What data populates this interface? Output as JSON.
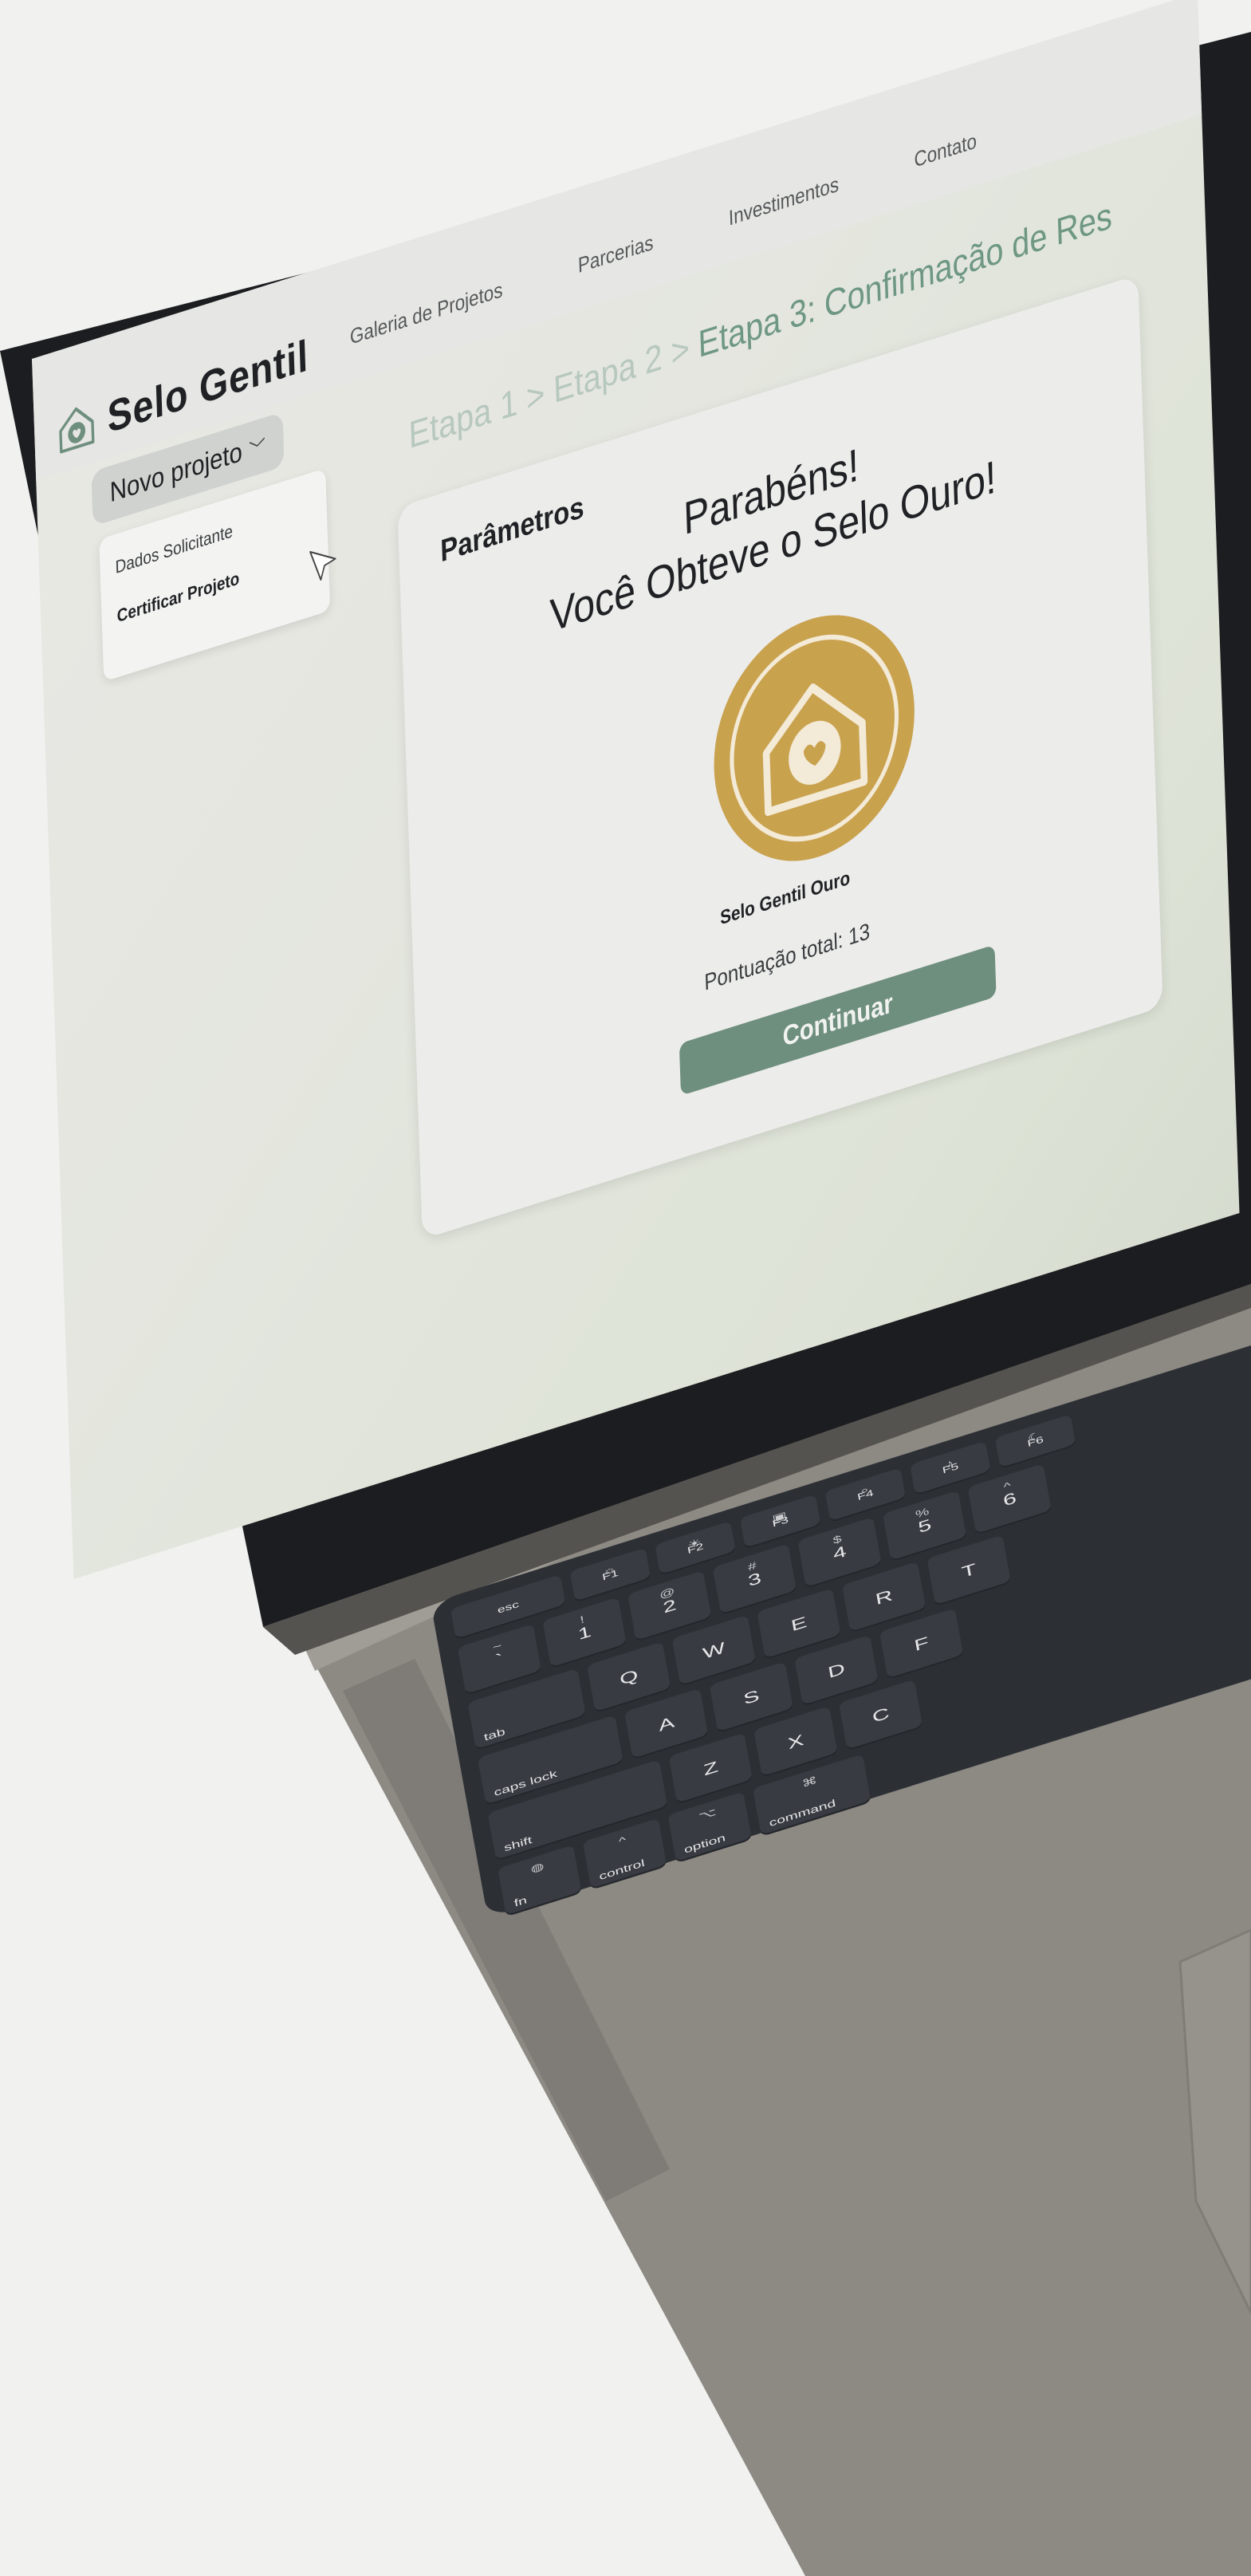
{
  "brand": {
    "name": "Selo Gentil"
  },
  "nav": {
    "items": [
      "Galeria de Projetos",
      "Parcerias",
      "Investimentos",
      "Contato"
    ]
  },
  "new_project": {
    "label": "Novo projeto",
    "menu": [
      {
        "label": "Dados Solicitante",
        "active": false
      },
      {
        "label": "Certificar Projeto",
        "active": true
      }
    ]
  },
  "breadcrumb": {
    "step1": "Etapa 1",
    "step2": "Etapa 2",
    "step3": "Etapa 3: Confirmação de Res",
    "separator": ">"
  },
  "card": {
    "title": "Parâmetros",
    "congrats_line1": "Parabéns!",
    "congrats_line2": "Você Obteve o Selo Ouro!",
    "seal_name": "Selo Gentil Ouro",
    "score_label": "Pontuação total:",
    "score_value": "13",
    "continue_label": "Continuar"
  },
  "colors": {
    "accent_green": "#6f8f7e",
    "breadcrumb_current": "#6e9784",
    "breadcrumb_past": "#b7c8bf",
    "seal_gold": "#c9a24e"
  },
  "keyboard": {
    "row_fn": [
      {
        "label": "esc"
      },
      {
        "label": "F1",
        "icon": "brightness-down-icon"
      },
      {
        "label": "F2",
        "icon": "brightness-up-icon"
      },
      {
        "label": "F3",
        "icon": "mission-control-icon"
      },
      {
        "label": "F4",
        "icon": "search-icon"
      },
      {
        "label": "F5",
        "icon": "microphone-icon"
      },
      {
        "label": "F6",
        "icon": "moon-icon"
      }
    ],
    "row_num": [
      {
        "sub": "~",
        "label": "`"
      },
      {
        "sub": "!",
        "label": "1"
      },
      {
        "sub": "@",
        "label": "2"
      },
      {
        "sub": "#",
        "label": "3"
      },
      {
        "sub": "$",
        "label": "4"
      },
      {
        "sub": "%",
        "label": "5"
      },
      {
        "sub": "^",
        "label": "6"
      }
    ],
    "row_q": [
      "tab",
      "Q",
      "W",
      "E",
      "R",
      "T"
    ],
    "row_a": [
      "caps lock",
      "A",
      "S",
      "D",
      "F"
    ],
    "row_z": [
      "shift",
      "Z",
      "X",
      "C"
    ],
    "row_mod": [
      "fn",
      "control",
      "option",
      "command"
    ],
    "mod_symbols": {
      "control": "^",
      "option": "⌥",
      "command": "⌘"
    }
  }
}
